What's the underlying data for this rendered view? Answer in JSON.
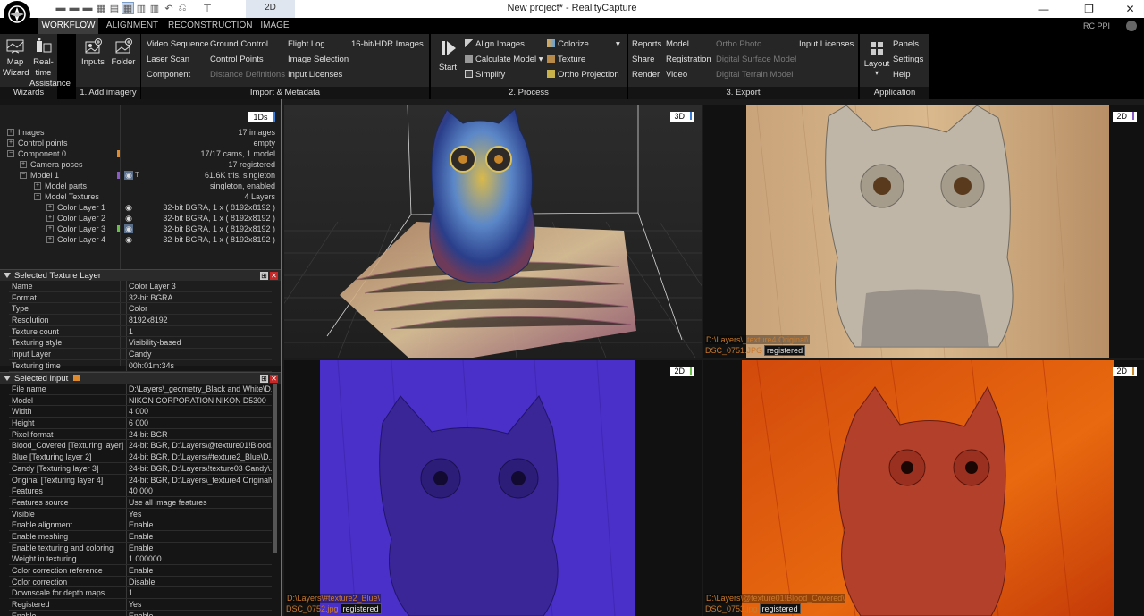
{
  "app": {
    "title": "New project* - RealityCapture",
    "view_mode": "2D",
    "rc_ppi": "RC PPI"
  },
  "quick_access": [
    "grid-1-icon",
    "grid-2-icon",
    "grid-3-icon",
    "grid-4-icon",
    "layout-icon",
    "undo-icon",
    "redo-icon",
    "dropdown-icon"
  ],
  "tabs": [
    {
      "label": "WORKFLOW",
      "active": true
    },
    {
      "label": "ALIGNMENT",
      "active": false
    },
    {
      "label": "RECONSTRUCTION",
      "active": false
    },
    {
      "label": "IMAGE",
      "active": false
    }
  ],
  "ribbon": {
    "wizards": {
      "label": "Wizards",
      "map_wizard": "Map\nWizard",
      "realtime": "Real-time\nAssistance"
    },
    "add_imagery": {
      "label": "1. Add imagery",
      "inputs": "Inputs",
      "folder": "Folder"
    },
    "import": {
      "label": "Import & Metadata",
      "col1": [
        "Video Sequence",
        "Laser Scan",
        "Component"
      ],
      "col2": [
        "Ground Control",
        "Control Points",
        "Distance Definitions"
      ],
      "col3": [
        "Flight Log",
        "Image Selection",
        "Input Licenses"
      ],
      "col4": [
        "16-bit/HDR Images"
      ]
    },
    "process": {
      "label": "2. Process",
      "start": "Start",
      "col1": [
        "Align Images",
        "Calculate Model",
        "Simplify"
      ],
      "col2": [
        "Colorize",
        "Texture",
        "Ortho Projection"
      ]
    },
    "export": {
      "label": "3. Export",
      "col1": [
        "Reports",
        "Share",
        "Render"
      ],
      "col2": [
        "Model",
        "Registration",
        "Video"
      ],
      "col3": [
        "Ortho Photo",
        "Digital Surface Model",
        "Digital Terrain Model"
      ],
      "col4": [
        "Input Licenses"
      ]
    },
    "application": {
      "label": "Application",
      "layout": "Layout",
      "col1": [
        "Panels",
        "Settings",
        "Help"
      ]
    }
  },
  "tree": {
    "badge": "1Ds",
    "rows": [
      {
        "label": "Images",
        "value": "17 images",
        "indent": 0
      },
      {
        "label": "Control points",
        "value": "empty",
        "indent": 0
      },
      {
        "label": "Component 0",
        "value": "17/17 cams, 1 model",
        "indent": 0
      },
      {
        "label": "Camera poses",
        "value": "17 registered",
        "indent": 1
      },
      {
        "label": "Model 1",
        "value": "61.6K tris, singleton",
        "indent": 1
      },
      {
        "label": "Model parts",
        "value": "singleton, enabled",
        "indent": 2
      },
      {
        "label": "Model Textures",
        "value": "4 Layers",
        "indent": 2
      },
      {
        "label": "Color Layer 1",
        "value": "32-bit BGRA, 1 x ( 8192x8192 )",
        "indent": 3
      },
      {
        "label": "Color Layer 2",
        "value": "32-bit BGRA, 1 x ( 8192x8192 )",
        "indent": 3
      },
      {
        "label": "Color Layer 3",
        "value": "32-bit BGRA, 1 x ( 8192x8192 )",
        "indent": 3
      },
      {
        "label": "Color Layer 4",
        "value": "32-bit BGRA, 1 x ( 8192x8192 )",
        "indent": 3
      }
    ]
  },
  "texture_panel": {
    "title": "Selected Texture Layer",
    "rows": [
      [
        "Name",
        "Color Layer 3"
      ],
      [
        "Format",
        "32-bit BGRA"
      ],
      [
        "Type",
        "Color"
      ],
      [
        "Resolution",
        "8192x8192"
      ],
      [
        "Texture count",
        "1"
      ],
      [
        "Texturing style",
        "Visibility-based"
      ],
      [
        "Input Layer",
        "Candy"
      ],
      [
        "Texturing time",
        "00h:01m:34s"
      ]
    ]
  },
  "input_panel": {
    "title": "Selected input",
    "rows": [
      [
        "File name",
        "D:\\Layers\\_geometry_Black and White\\D..."
      ],
      [
        "Model",
        "NIKON CORPORATION NIKON D5300"
      ],
      [
        "Width",
        "4 000"
      ],
      [
        "Height",
        "6 000"
      ],
      [
        "Pixel format",
        "24-bit BGR"
      ],
      [
        "Blood_Covered [Texturing layer]",
        "24-bit BGR, D:\\Layers\\@texture01!Blood..."
      ],
      [
        "Blue [Texturing layer 2]",
        "24-bit BGR, D:\\Layers\\#texture2_Blue\\D..."
      ],
      [
        "Candy [Texturing layer 3]",
        "24-bit BGR, D:\\Layers\\!texture03 Candy\\..."
      ],
      [
        "Original [Texturing layer 4]",
        "24-bit BGR, D:\\Layers\\_texture4 Original\\..."
      ],
      [
        "Features",
        "40 000"
      ],
      [
        "Features source",
        "Use all image features"
      ],
      [
        "Visible",
        "Yes"
      ],
      [
        "Enable alignment",
        "Enable"
      ],
      [
        "Enable meshing",
        "Enable"
      ],
      [
        "Enable texturing and coloring",
        "Enable"
      ],
      [
        "Weight in texturing",
        "1.000000"
      ],
      [
        "Color correction reference",
        "Enable"
      ],
      [
        "Color correction",
        "Disable"
      ],
      [
        "Downscale for depth maps",
        "1"
      ],
      [
        "Registered",
        "Yes"
      ],
      [
        "Enable ...",
        "Enable"
      ]
    ]
  },
  "viewports": {
    "v3d": {
      "badge": "3D"
    },
    "top_right": {
      "badge": "2D",
      "path": "D:\\Layers\\_texture4 Original\\",
      "file": "DSC_0751.JPG",
      "status": "registered"
    },
    "bottom_left": {
      "badge": "2D",
      "path": "D:\\Layers\\#texture2_Blue\\",
      "file": "DSC_0752.jpg",
      "status": "registered"
    },
    "bottom_right": {
      "badge": "2D",
      "path": "D:\\Layers\\@texture01!Blood_Covered\\",
      "file": "DSC_0753.jpg",
      "status": "registered"
    }
  },
  "colors": {
    "accent": "#3a7bd5",
    "layer_mark_orange": "#e08a2e",
    "layer_mark_purple": "#8a5ac8",
    "layer_mark_green": "#6abf4b",
    "caption_orange": "#c87a2e"
  }
}
